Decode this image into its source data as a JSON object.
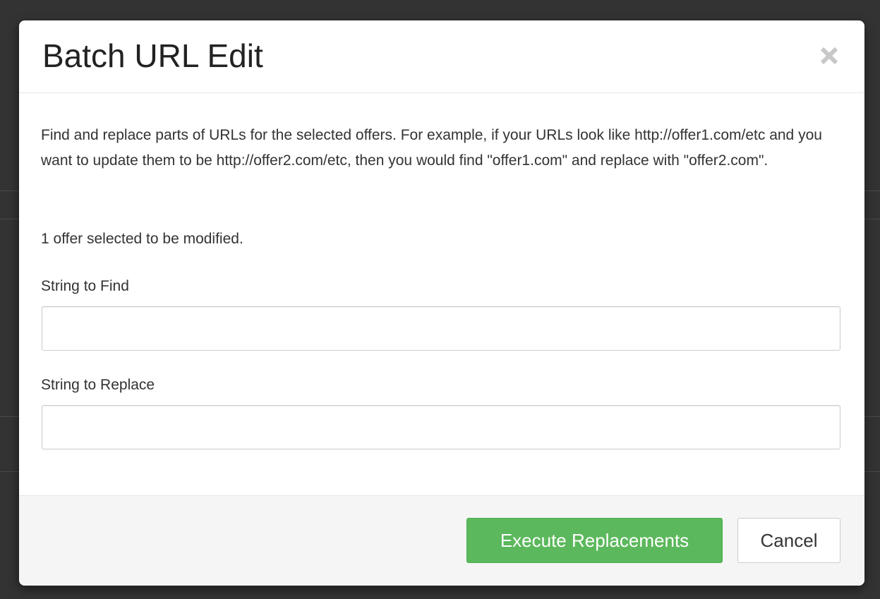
{
  "modal": {
    "title": "Batch URL Edit",
    "close_icon": "close-icon",
    "description": "Find and replace parts of URLs for the selected offers. For example, if your URLs look like http://offer1.com/etc and you want to update them to be http://offer2.com/etc, then you would find \"offer1.com\" and replace with \"offer2.com\".",
    "selected_count_text": "1 offer selected to be modified.",
    "find_field": {
      "label": "String to Find",
      "value": "",
      "placeholder": ""
    },
    "replace_field": {
      "label": "String to Replace",
      "value": "",
      "placeholder": ""
    },
    "footer": {
      "execute_label": "Execute Replacements",
      "cancel_label": "Cancel"
    }
  },
  "colors": {
    "primary_success": "#5cb85c",
    "backdrop": "#333333",
    "footer_bg": "#f5f5f5"
  }
}
